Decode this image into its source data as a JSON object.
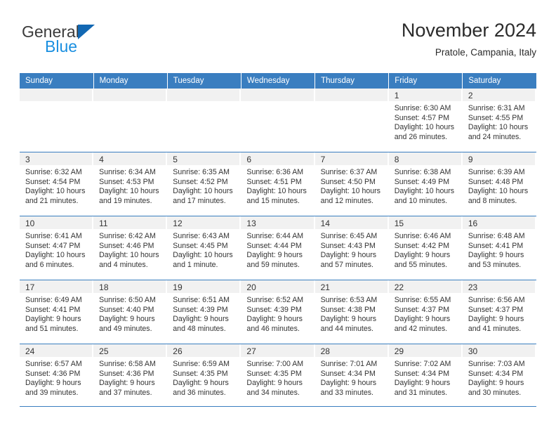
{
  "brand": {
    "name_part1": "General",
    "name_part2": "Blue",
    "triangle_icon": "triangle-icon",
    "accent_color": "#1268b3",
    "light_blue": "#1a8fe0"
  },
  "header": {
    "title": "November 2024",
    "subtitle": "Pratole, Campania, Italy"
  },
  "theme": {
    "header_row_color": "#3a7ec0",
    "day_strip_color": "#f1f1f1",
    "text_color": "#333333"
  },
  "weekday_headers": [
    "Sunday",
    "Monday",
    "Tuesday",
    "Wednesday",
    "Thursday",
    "Friday",
    "Saturday"
  ],
  "weeks": [
    [
      {
        "day": "",
        "sunrise": "",
        "sunset": "",
        "daylight1": "",
        "daylight2": "",
        "empty": true
      },
      {
        "day": "",
        "sunrise": "",
        "sunset": "",
        "daylight1": "",
        "daylight2": "",
        "empty": true
      },
      {
        "day": "",
        "sunrise": "",
        "sunset": "",
        "daylight1": "",
        "daylight2": "",
        "empty": true
      },
      {
        "day": "",
        "sunrise": "",
        "sunset": "",
        "daylight1": "",
        "daylight2": "",
        "empty": true
      },
      {
        "day": "",
        "sunrise": "",
        "sunset": "",
        "daylight1": "",
        "daylight2": "",
        "empty": true
      },
      {
        "day": "1",
        "sunrise": "Sunrise: 6:30 AM",
        "sunset": "Sunset: 4:57 PM",
        "daylight1": "Daylight: 10 hours",
        "daylight2": "and 26 minutes.",
        "empty": false
      },
      {
        "day": "2",
        "sunrise": "Sunrise: 6:31 AM",
        "sunset": "Sunset: 4:55 PM",
        "daylight1": "Daylight: 10 hours",
        "daylight2": "and 24 minutes.",
        "empty": false
      }
    ],
    [
      {
        "day": "3",
        "sunrise": "Sunrise: 6:32 AM",
        "sunset": "Sunset: 4:54 PM",
        "daylight1": "Daylight: 10 hours",
        "daylight2": "and 21 minutes.",
        "empty": false
      },
      {
        "day": "4",
        "sunrise": "Sunrise: 6:34 AM",
        "sunset": "Sunset: 4:53 PM",
        "daylight1": "Daylight: 10 hours",
        "daylight2": "and 19 minutes.",
        "empty": false
      },
      {
        "day": "5",
        "sunrise": "Sunrise: 6:35 AM",
        "sunset": "Sunset: 4:52 PM",
        "daylight1": "Daylight: 10 hours",
        "daylight2": "and 17 minutes.",
        "empty": false
      },
      {
        "day": "6",
        "sunrise": "Sunrise: 6:36 AM",
        "sunset": "Sunset: 4:51 PM",
        "daylight1": "Daylight: 10 hours",
        "daylight2": "and 15 minutes.",
        "empty": false
      },
      {
        "day": "7",
        "sunrise": "Sunrise: 6:37 AM",
        "sunset": "Sunset: 4:50 PM",
        "daylight1": "Daylight: 10 hours",
        "daylight2": "and 12 minutes.",
        "empty": false
      },
      {
        "day": "8",
        "sunrise": "Sunrise: 6:38 AM",
        "sunset": "Sunset: 4:49 PM",
        "daylight1": "Daylight: 10 hours",
        "daylight2": "and 10 minutes.",
        "empty": false
      },
      {
        "day": "9",
        "sunrise": "Sunrise: 6:39 AM",
        "sunset": "Sunset: 4:48 PM",
        "daylight1": "Daylight: 10 hours",
        "daylight2": "and 8 minutes.",
        "empty": false
      }
    ],
    [
      {
        "day": "10",
        "sunrise": "Sunrise: 6:41 AM",
        "sunset": "Sunset: 4:47 PM",
        "daylight1": "Daylight: 10 hours",
        "daylight2": "and 6 minutes.",
        "empty": false
      },
      {
        "day": "11",
        "sunrise": "Sunrise: 6:42 AM",
        "sunset": "Sunset: 4:46 PM",
        "daylight1": "Daylight: 10 hours",
        "daylight2": "and 4 minutes.",
        "empty": false
      },
      {
        "day": "12",
        "sunrise": "Sunrise: 6:43 AM",
        "sunset": "Sunset: 4:45 PM",
        "daylight1": "Daylight: 10 hours",
        "daylight2": "and 1 minute.",
        "empty": false
      },
      {
        "day": "13",
        "sunrise": "Sunrise: 6:44 AM",
        "sunset": "Sunset: 4:44 PM",
        "daylight1": "Daylight: 9 hours",
        "daylight2": "and 59 minutes.",
        "empty": false
      },
      {
        "day": "14",
        "sunrise": "Sunrise: 6:45 AM",
        "sunset": "Sunset: 4:43 PM",
        "daylight1": "Daylight: 9 hours",
        "daylight2": "and 57 minutes.",
        "empty": false
      },
      {
        "day": "15",
        "sunrise": "Sunrise: 6:46 AM",
        "sunset": "Sunset: 4:42 PM",
        "daylight1": "Daylight: 9 hours",
        "daylight2": "and 55 minutes.",
        "empty": false
      },
      {
        "day": "16",
        "sunrise": "Sunrise: 6:48 AM",
        "sunset": "Sunset: 4:41 PM",
        "daylight1": "Daylight: 9 hours",
        "daylight2": "and 53 minutes.",
        "empty": false
      }
    ],
    [
      {
        "day": "17",
        "sunrise": "Sunrise: 6:49 AM",
        "sunset": "Sunset: 4:41 PM",
        "daylight1": "Daylight: 9 hours",
        "daylight2": "and 51 minutes.",
        "empty": false
      },
      {
        "day": "18",
        "sunrise": "Sunrise: 6:50 AM",
        "sunset": "Sunset: 4:40 PM",
        "daylight1": "Daylight: 9 hours",
        "daylight2": "and 49 minutes.",
        "empty": false
      },
      {
        "day": "19",
        "sunrise": "Sunrise: 6:51 AM",
        "sunset": "Sunset: 4:39 PM",
        "daylight1": "Daylight: 9 hours",
        "daylight2": "and 48 minutes.",
        "empty": false
      },
      {
        "day": "20",
        "sunrise": "Sunrise: 6:52 AM",
        "sunset": "Sunset: 4:39 PM",
        "daylight1": "Daylight: 9 hours",
        "daylight2": "and 46 minutes.",
        "empty": false
      },
      {
        "day": "21",
        "sunrise": "Sunrise: 6:53 AM",
        "sunset": "Sunset: 4:38 PM",
        "daylight1": "Daylight: 9 hours",
        "daylight2": "and 44 minutes.",
        "empty": false
      },
      {
        "day": "22",
        "sunrise": "Sunrise: 6:55 AM",
        "sunset": "Sunset: 4:37 PM",
        "daylight1": "Daylight: 9 hours",
        "daylight2": "and 42 minutes.",
        "empty": false
      },
      {
        "day": "23",
        "sunrise": "Sunrise: 6:56 AM",
        "sunset": "Sunset: 4:37 PM",
        "daylight1": "Daylight: 9 hours",
        "daylight2": "and 41 minutes.",
        "empty": false
      }
    ],
    [
      {
        "day": "24",
        "sunrise": "Sunrise: 6:57 AM",
        "sunset": "Sunset: 4:36 PM",
        "daylight1": "Daylight: 9 hours",
        "daylight2": "and 39 minutes.",
        "empty": false
      },
      {
        "day": "25",
        "sunrise": "Sunrise: 6:58 AM",
        "sunset": "Sunset: 4:36 PM",
        "daylight1": "Daylight: 9 hours",
        "daylight2": "and 37 minutes.",
        "empty": false
      },
      {
        "day": "26",
        "sunrise": "Sunrise: 6:59 AM",
        "sunset": "Sunset: 4:35 PM",
        "daylight1": "Daylight: 9 hours",
        "daylight2": "and 36 minutes.",
        "empty": false
      },
      {
        "day": "27",
        "sunrise": "Sunrise: 7:00 AM",
        "sunset": "Sunset: 4:35 PM",
        "daylight1": "Daylight: 9 hours",
        "daylight2": "and 34 minutes.",
        "empty": false
      },
      {
        "day": "28",
        "sunrise": "Sunrise: 7:01 AM",
        "sunset": "Sunset: 4:34 PM",
        "daylight1": "Daylight: 9 hours",
        "daylight2": "and 33 minutes.",
        "empty": false
      },
      {
        "day": "29",
        "sunrise": "Sunrise: 7:02 AM",
        "sunset": "Sunset: 4:34 PM",
        "daylight1": "Daylight: 9 hours",
        "daylight2": "and 31 minutes.",
        "empty": false
      },
      {
        "day": "30",
        "sunrise": "Sunrise: 7:03 AM",
        "sunset": "Sunset: 4:34 PM",
        "daylight1": "Daylight: 9 hours",
        "daylight2": "and 30 minutes.",
        "empty": false
      }
    ]
  ]
}
